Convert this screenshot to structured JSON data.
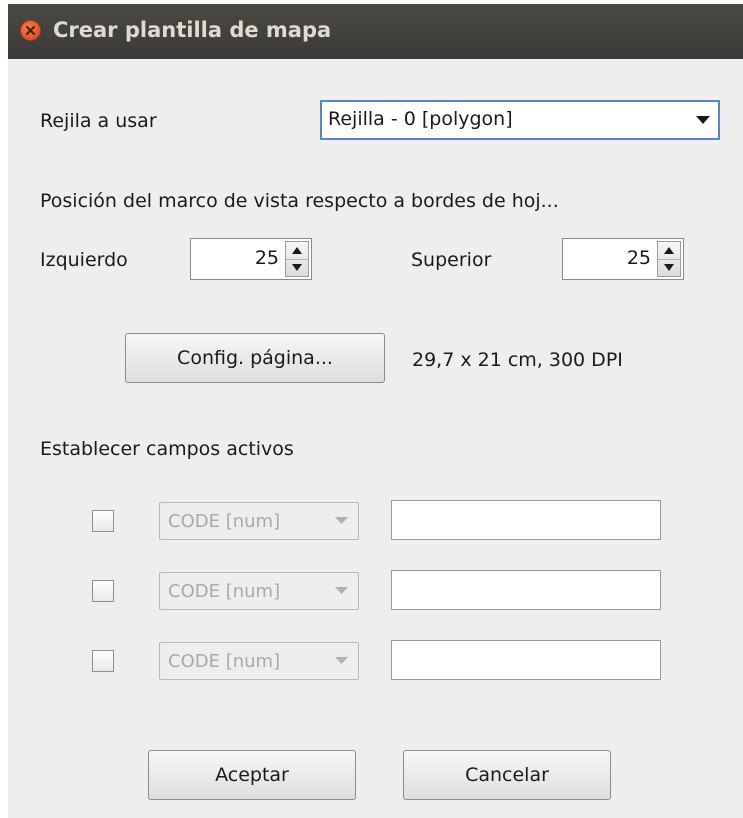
{
  "window": {
    "title": "Crear plantilla de mapa"
  },
  "grid": {
    "label": "Rejila a usar",
    "selected": "Rejilla - 0 [polygon]"
  },
  "position": {
    "heading": "Posición del marco de vista respecto a bordes de hoj...",
    "left_label": "Izquierdo",
    "left_value": "25",
    "top_label": "Superior",
    "top_value": "25"
  },
  "page": {
    "config_button": "Config. página...",
    "info": "29,7 x 21 cm, 300 DPI"
  },
  "fields": {
    "heading": "Establecer campos activos",
    "rows": [
      {
        "checked": false,
        "field": "CODE [num]",
        "value": ""
      },
      {
        "checked": false,
        "field": "CODE [num]",
        "value": ""
      },
      {
        "checked": false,
        "field": "CODE [num]",
        "value": ""
      }
    ]
  },
  "buttons": {
    "accept": "Aceptar",
    "cancel": "Cancelar"
  },
  "colors": {
    "titlebar": "#3c3b37",
    "close": "#e0502a",
    "focus_border": "#5b82c3",
    "dialog_bg": "#eeeeee"
  }
}
